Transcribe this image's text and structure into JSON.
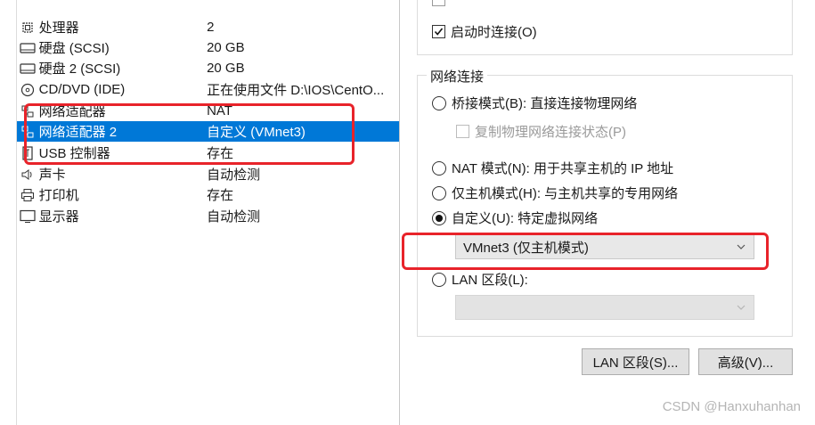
{
  "devices": [
    {
      "name": "处理器",
      "summary": "2",
      "icon": "cpu-icon"
    },
    {
      "name": "硬盘 (SCSI)",
      "summary": "20 GB",
      "icon": "hard-disk-icon"
    },
    {
      "name": "硬盘 2 (SCSI)",
      "summary": "20 GB",
      "icon": "hard-disk-icon"
    },
    {
      "name": "CD/DVD (IDE)",
      "summary": "正在使用文件 D:\\IOS\\CentO...",
      "icon": "cd-dvd-icon"
    },
    {
      "name": "网络适配器",
      "summary": "NAT",
      "icon": "network-adapter-icon"
    },
    {
      "name": "网络适配器 2",
      "summary": "自定义 (VMnet3)",
      "icon": "network-adapter-icon",
      "selected": true
    },
    {
      "name": "USB 控制器",
      "summary": "存在",
      "icon": "usb-icon"
    },
    {
      "name": "声卡",
      "summary": "自动检测",
      "icon": "speaker-icon"
    },
    {
      "name": "打印机",
      "summary": "存在",
      "icon": "printer-icon"
    },
    {
      "name": "显示器",
      "summary": "自动检测",
      "icon": "monitor-icon"
    }
  ],
  "device_status": {
    "connect_at_power_on": {
      "label": "启动时连接(O)",
      "checked": true
    }
  },
  "network_connection": {
    "legend": "网络连接",
    "bridged": {
      "label": "桥接模式(B): 直接连接物理网络",
      "checked": false
    },
    "replicate": {
      "label": "复制物理网络连接状态(P)",
      "checked": false,
      "disabled": true
    },
    "nat": {
      "label": "NAT 模式(N): 用于共享主机的 IP 地址",
      "checked": false
    },
    "host_only": {
      "label": "仅主机模式(H): 与主机共享的专用网络",
      "checked": false
    },
    "custom": {
      "label": "自定义(U): 特定虚拟网络",
      "checked": true
    },
    "custom_network_value": "VMnet3 (仅主机模式)",
    "lan_segment": {
      "label": "LAN 区段(L):",
      "checked": false
    },
    "lan_segment_value": ""
  },
  "buttons": {
    "lan_segments": "LAN 区段(S)...",
    "advanced": "高级(V)..."
  },
  "watermark": "CSDN @Hanxuhanhan",
  "colors": {
    "selection": "#0078d7",
    "annotation": "#e8232a"
  }
}
